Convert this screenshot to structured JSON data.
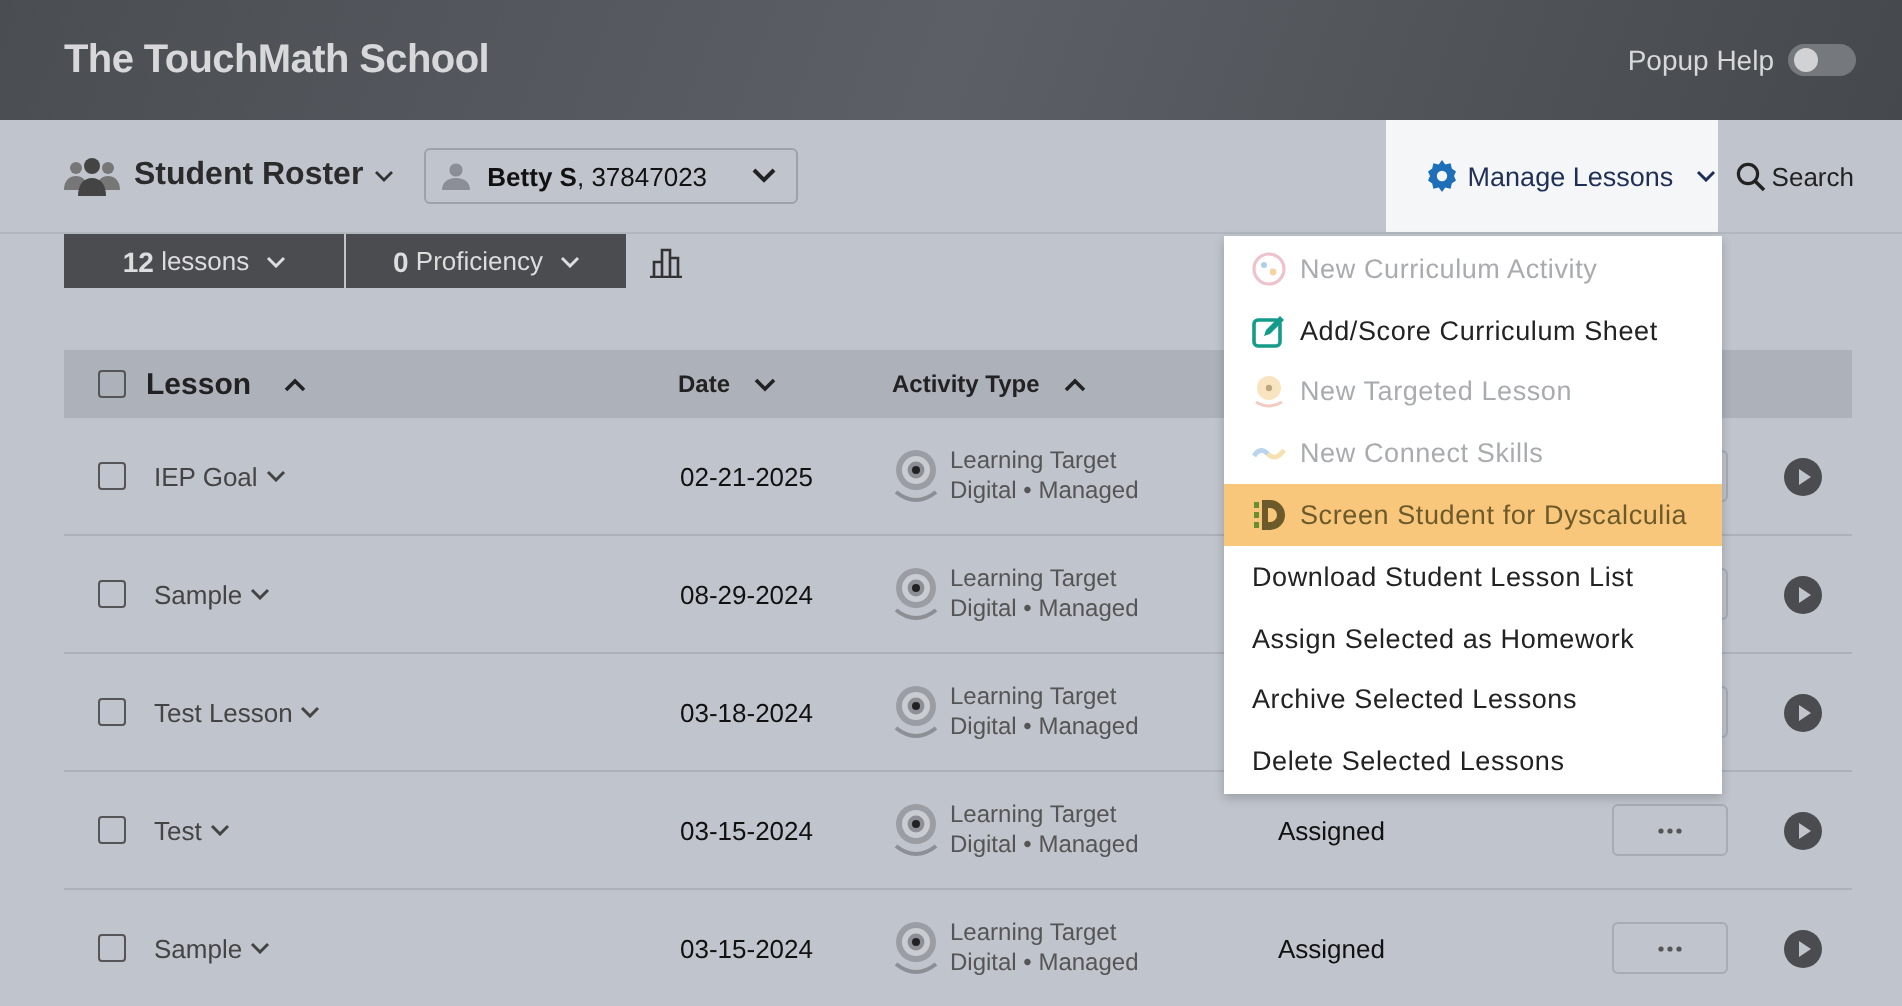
{
  "header": {
    "title": "The TouchMath School",
    "popup_help": {
      "label": "Popup Help",
      "on": false
    }
  },
  "toolbar": {
    "roster": "Student Roster",
    "student": "**Betty S**, 37847023",
    "manage": "Manage Lessons",
    "search": "Search"
  },
  "filters": [
    {
      "count": "12",
      "label": "lessons"
    },
    {
      "count": "0",
      "label": "Proficiency"
    }
  ],
  "table": {
    "all_checked": false,
    "columns": [
      {
        "label": "Lesson",
        "sort_ascending": true
      },
      {
        "label": "Date",
        "sort_ascending": false
      },
      {
        "label": "Activity Type",
        "sort_ascending": true
      }
    ],
    "rows": [
      {
        "lesson": "IEP Goal",
        "checked": false,
        "date": "02-21-2025",
        "activity": "Learning Target",
        "mode": "Digital • Managed"
      },
      {
        "lesson": "Sample",
        "checked": false,
        "date": "08-29-2024",
        "activity": "Learning Target",
        "mode": "Digital • Managed"
      },
      {
        "lesson": "Test Lesson",
        "checked": false,
        "date": "03-18-2024",
        "activity": "Learning Target",
        "mode": "Digital • Managed"
      },
      {
        "lesson": "Test",
        "checked": false,
        "date": "03-15-2024",
        "activity": "Learning Target",
        "mode": "Digital • Managed",
        "status": "Assigned"
      },
      {
        "lesson": "Sample",
        "checked": false,
        "date": "03-15-2024",
        "activity": "Learning Target",
        "mode": "Digital • Managed",
        "status": "Assigned"
      }
    ]
  },
  "menu": {
    "items": [
      {
        "label": "New Curriculum Activity",
        "kind": "curriculum",
        "disabled": true,
        "selected": false
      },
      {
        "label": "Add/Score Curriculum Sheet",
        "kind": "sheet",
        "disabled": false,
        "selected": false
      },
      {
        "label": "New Targeted Lesson",
        "kind": "target",
        "disabled": true,
        "selected": false
      },
      {
        "label": "New Connect Skills",
        "kind": "connect",
        "disabled": true,
        "selected": false
      },
      {
        "label": "Screen Student for Dyscalculia",
        "kind": "screen",
        "disabled": false,
        "selected": true
      },
      {
        "label": "Download Student Lesson List",
        "disabled": false,
        "selected": false
      },
      {
        "label": "Assign Selected as Homework",
        "disabled": false,
        "selected": false
      },
      {
        "label": "Archive Selected Lessons",
        "disabled": false,
        "selected": false
      },
      {
        "label": "Delete Selected Lessons",
        "disabled": false,
        "selected": false
      }
    ]
  }
}
